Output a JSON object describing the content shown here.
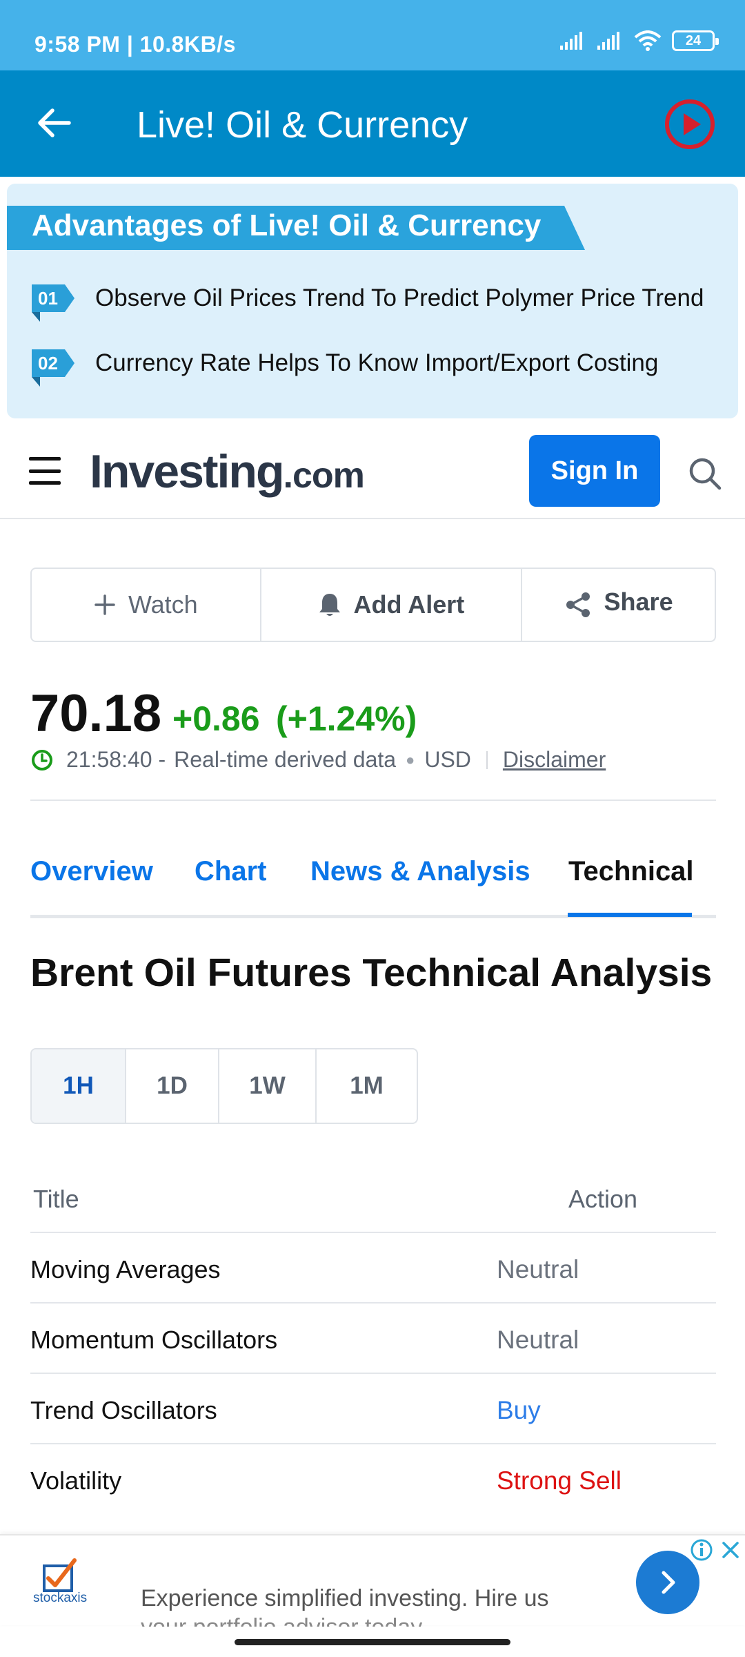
{
  "status_bar": {
    "time": "9:58 PM | 10.8KB/s",
    "battery": "24"
  },
  "app_bar": {
    "title": "Live! Oil & Currency"
  },
  "advantages": {
    "title": "Advantages of Live! Oil & Currency",
    "items": [
      {
        "num": "01",
        "text": "Observe Oil Prices Trend To Predict Polymer Price Trend"
      },
      {
        "num": "02",
        "text": "Currency Rate Helps To Know Import/Export Costing"
      }
    ]
  },
  "investing": {
    "logo": "Investing",
    "logo_suffix": ".com",
    "sign_in": "Sign In"
  },
  "actions": {
    "watch": "Watch",
    "add_alert": "Add Alert",
    "share": "Share"
  },
  "price": {
    "last": "70.18",
    "change": "+0.86",
    "change_pct": "(+1.24%)",
    "time": "21:58:40 -",
    "source": "Real-time derived data",
    "currency": "USD",
    "disclaimer": "Disclaimer"
  },
  "tabs": [
    "Overview",
    "Chart",
    "News & Analysis",
    "Technical"
  ],
  "section_title": "Brent Oil Futures Technical Analysis",
  "timeframes": [
    "1H",
    "1D",
    "1W",
    "1M"
  ],
  "table": {
    "header_title": "Title",
    "header_action": "Action",
    "rows": [
      {
        "title": "Moving Averages",
        "action": "Neutral"
      },
      {
        "title": "Momentum Oscillators",
        "action": "Neutral"
      },
      {
        "title": "Trend Oscillators",
        "action": "Buy"
      },
      {
        "title": "Volatility",
        "action": "Strong Sell"
      }
    ]
  },
  "ad": {
    "brand": "stockaxis",
    "text": "Experience simplified investing. Hire us",
    "text2": "your portfolio advisor today"
  },
  "colors": {
    "status_bar": "#45b2ea",
    "app_bar": "#0089c7",
    "accent": "#0a75e8",
    "positive": "#1a9c1a",
    "sell": "#dd1212",
    "buy": "#2d7de8"
  }
}
